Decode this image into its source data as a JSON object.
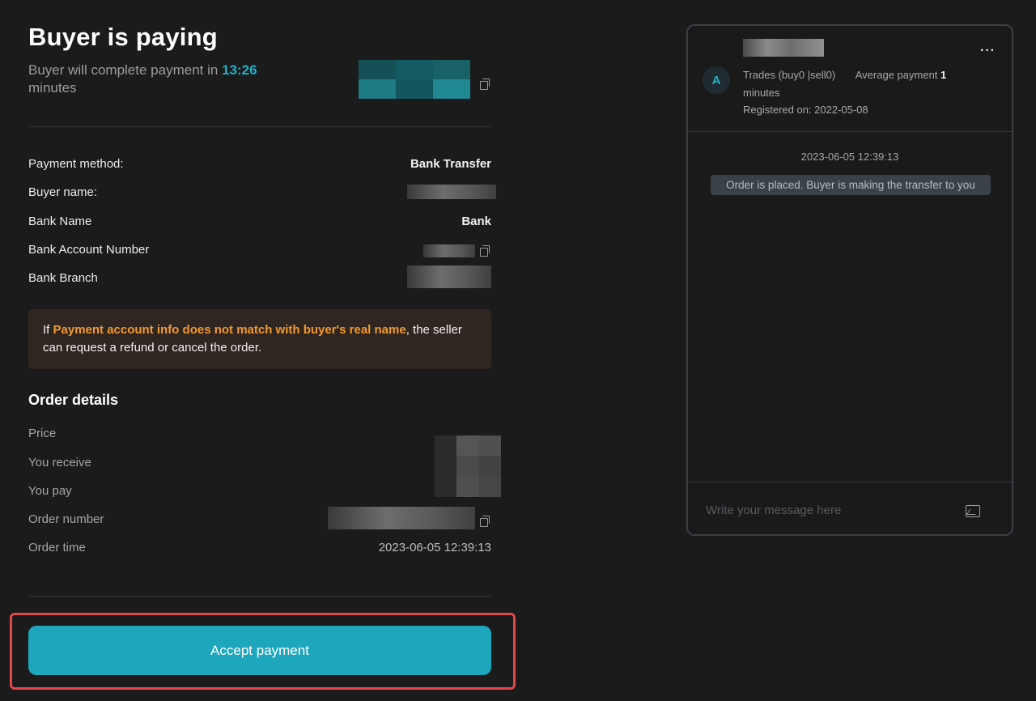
{
  "header": {
    "title": "Buyer is paying",
    "subtitle_prefix": "Buyer will complete payment in",
    "timer": "13:26",
    "subtitle_suffix": "minutes"
  },
  "payment": {
    "rows": [
      {
        "label": "Payment method:",
        "value": "Bank Transfer"
      },
      {
        "label": "Buyer name:",
        "value": ""
      },
      {
        "label": "Bank Name",
        "value": "Bank"
      },
      {
        "label": "Bank Account Number",
        "value": ""
      },
      {
        "label": "Bank Branch",
        "value": ""
      }
    ]
  },
  "warning": {
    "prefix": "If ",
    "highlight": "Payment account info does not match with buyer's real name",
    "suffix": ", the seller can request a refund or cancel the order."
  },
  "order_details": {
    "title": "Order details",
    "rows": [
      {
        "label": "Price",
        "value": ""
      },
      {
        "label": "You receive",
        "value": ""
      },
      {
        "label": "You pay",
        "value": ""
      },
      {
        "label": "Order number",
        "value": ""
      },
      {
        "label": "Order time",
        "value": "2023-06-05 12:39:13"
      }
    ]
  },
  "actions": {
    "accept_label": "Accept payment"
  },
  "chat": {
    "avatar_letter": "A",
    "trades": "Trades (buy0 |sell0)",
    "avg_payment_label": "Average payment",
    "avg_payment_value": "1",
    "avg_payment_unit": "minutes",
    "registered": "Registered on: 2022-05-08",
    "more_label": "···",
    "message_time": "2023-06-05 12:39:13",
    "system_message": "Order is placed. Buyer is making the transfer to you",
    "input_placeholder": "Write your message here"
  },
  "colors": {
    "accent": "#1ea6bd",
    "timer": "#1fb2c8",
    "warning_highlight": "#f19a2f",
    "highlight_border": "#e2474b"
  },
  "icons": [
    "copy-icon",
    "more-icon",
    "image-icon"
  ]
}
